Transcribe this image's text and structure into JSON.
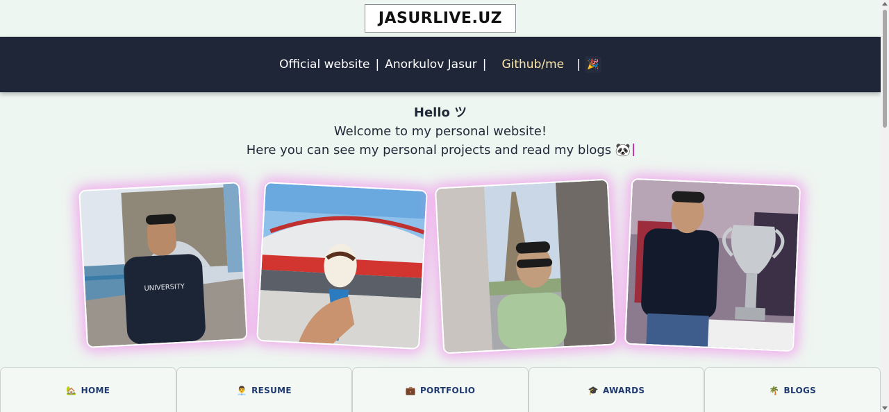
{
  "logo": {
    "text": "JASURLIVE.UZ"
  },
  "topbar": {
    "official": "Official website",
    "sep1": "|",
    "name": "Anorkulov Jasur",
    "sep2": "|",
    "github": "Github/me",
    "sep3": "|",
    "party_emoji": "🎉"
  },
  "intro": {
    "hello": "Hello ツ",
    "welcome": "Welcome to my personal website!",
    "projects": "Here you can see my personal projects and read my blogs 🐼"
  },
  "photos": [
    {
      "name": "tower-bridge-photo",
      "desc": ""
    },
    {
      "name": "stadium-ice-cream-photo",
      "desc": ""
    },
    {
      "name": "eiffel-tower-selfie-photo",
      "desc": ""
    },
    {
      "name": "trophy-photo",
      "desc": ""
    }
  ],
  "nav": {
    "home": {
      "icon": "🏡",
      "label": "HOME"
    },
    "resume": {
      "icon": "👨‍💼",
      "label": "RESUME"
    },
    "portfolio": {
      "icon": "💼",
      "label": "PORTFOLIO"
    },
    "awards": {
      "icon": "🎓",
      "label": "AWARDS"
    },
    "blogs": {
      "icon": "🌴",
      "label": "BLOGS"
    }
  },
  "colors": {
    "background": "#eef6f1",
    "topbar": "#1e2638",
    "github_link": "#fde7a8",
    "nav_text": "#1e3a70",
    "glow": "#f096eb"
  }
}
